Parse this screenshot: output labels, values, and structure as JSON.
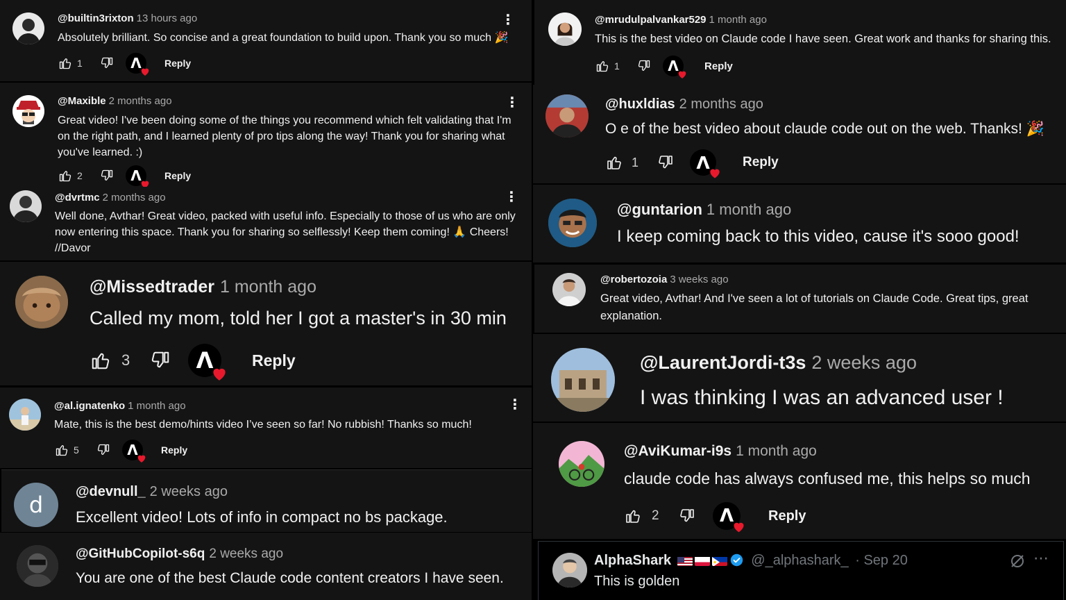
{
  "app": {
    "reply_label": "Reply"
  },
  "comments": [
    {
      "handle": "@builtin3rixton",
      "time": "13 hours ago",
      "text": "Absolutely brilliant. So concise and a great foundation to build upon. Thank you so much 🎉",
      "likes": "1"
    },
    {
      "handle": "@Maxible",
      "time": "2 months ago",
      "text": "Great video! I've been doing some of the things you recommend which felt validating that I'm on the right path, and I learned plenty of pro tips along the way! Thank you for sharing what you've learned. :)",
      "likes": "2"
    },
    {
      "handle": "@dvrtmc",
      "time": "2 months ago",
      "text": "Well done, Avthar! Great video, packed with useful info. Especially to those of us who are only now entering this space. Thank you for sharing so selflessly! Keep them coming! 🙏 Cheers! //Davor",
      "likes": ""
    },
    {
      "handle": "@Missedtrader",
      "time": "1 month ago",
      "text": "Called my mom, told her I got a master's in 30 min",
      "likes": "3"
    },
    {
      "handle": "@al.ignatenko",
      "time": "1 month ago",
      "text": "Mate, this is the best demo/hints video I’ve seen so far! No rubbish! Thanks so much!",
      "likes": "5"
    },
    {
      "handle": "@devnull_",
      "time": "2 weeks ago",
      "text": "Excellent video! Lots of info in compact no bs package.",
      "likes": "",
      "avatar_letter": "d"
    },
    {
      "handle": "@GitHubCopilot-s6q",
      "time": "2 weeks ago",
      "text": "You are one of the best Claude code content creators I have seen.",
      "likes": ""
    },
    {
      "handle": "@mrudulpalvankar529",
      "time": "1 month ago",
      "text": "This is the best video on Claude code I have seen. Great work and thanks for sharing this.",
      "likes": "1"
    },
    {
      "handle": "@huxldias",
      "time": "2 months ago",
      "text": "O e of the best video about claude code out on the web. Thanks! 🎉",
      "likes": "1"
    },
    {
      "handle": "@guntarion",
      "time": "1 month ago",
      "text": "I keep coming back to this video, cause it's sooo good!",
      "likes": ""
    },
    {
      "handle": "@robertozoia",
      "time": "3 weeks ago",
      "text": "Great video, Avthar! And I've seen a lot of tutorials on Claude Code. Great tips, great explanation.",
      "likes": ""
    },
    {
      "handle": "@LaurentJordi-t3s",
      "time": "2 weeks ago",
      "text": "I was thinking I was an advanced user !",
      "likes": ""
    },
    {
      "handle": "@AviKumar-i9s",
      "time": "1 month ago",
      "text": "claude code has always confused me, this helps so much",
      "likes": "2"
    }
  ],
  "tweet": {
    "name": "AlphaShark",
    "handle": "@_alphashark_",
    "date": "· Sep 20",
    "text": "This is golden"
  },
  "colors": {
    "panel_bg": "#141414",
    "text": "#f1f1f1",
    "muted": "#aaaaaa",
    "heart": "#e8192c",
    "verified": "#1d9bf0"
  }
}
